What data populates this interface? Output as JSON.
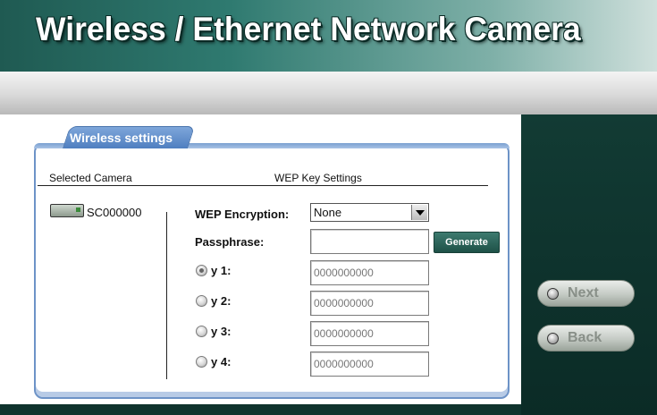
{
  "header": {
    "title": "Wireless / Ethernet Network Camera"
  },
  "panel": {
    "tab_label": "Wireless settings",
    "selected_camera_header": "Selected Camera",
    "wep_header": "WEP Key Settings",
    "camera_name": "SC000000"
  },
  "wep": {
    "encryption_label": "WEP Encryption:",
    "encryption_value": "None",
    "passphrase_label": "Passphrase:",
    "passphrase_value": "",
    "generate_label": "Generate",
    "keys": [
      {
        "label": "y 1:",
        "value": "0000000000",
        "selected": true
      },
      {
        "label": "y 2:",
        "value": "0000000000",
        "selected": false
      },
      {
        "label": "y 3:",
        "value": "0000000000",
        "selected": false
      },
      {
        "label": "y 4:",
        "value": "0000000000",
        "selected": false
      }
    ]
  },
  "nav": {
    "next_label": "Next",
    "back_label": "Back"
  }
}
